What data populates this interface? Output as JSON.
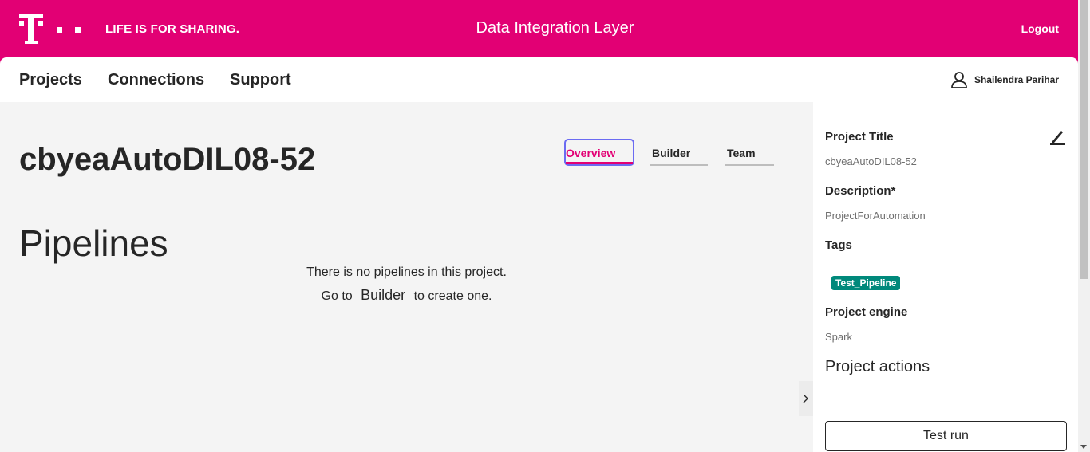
{
  "header": {
    "slogan": "LIFE IS FOR SHARING.",
    "app_title": "Data Integration Layer",
    "logout_label": "Logout",
    "brand_color": "#e20074"
  },
  "nav": {
    "items": [
      "Projects",
      "Connections",
      "Support"
    ],
    "user_name": "Shailendra Parihar"
  },
  "main": {
    "project_name": "cbyeaAutoDIL08-52",
    "tabs": [
      {
        "label": "Overview",
        "active": true
      },
      {
        "label": "Builder",
        "active": false
      },
      {
        "label": "Team",
        "active": false
      }
    ],
    "section_title": "Pipelines",
    "empty_line1": "There is no pipelines in this project.",
    "empty_go_to": "Go to",
    "empty_link": "Builder",
    "empty_suffix": "to create one.",
    "expand_icon": "chevron-right-icon"
  },
  "sidebar": {
    "project_title_label": "Project Title",
    "project_title_value": "cbyeaAutoDIL08-52",
    "description_label": "Description*",
    "description_value": "ProjectForAutomation",
    "tags_label": "Tags",
    "tags": [
      "Test_Pipeline"
    ],
    "tag_color": "#00897b",
    "engine_label": "Project engine",
    "engine_value": "Spark",
    "actions_title": "Project actions",
    "test_run_label": "Test run"
  }
}
